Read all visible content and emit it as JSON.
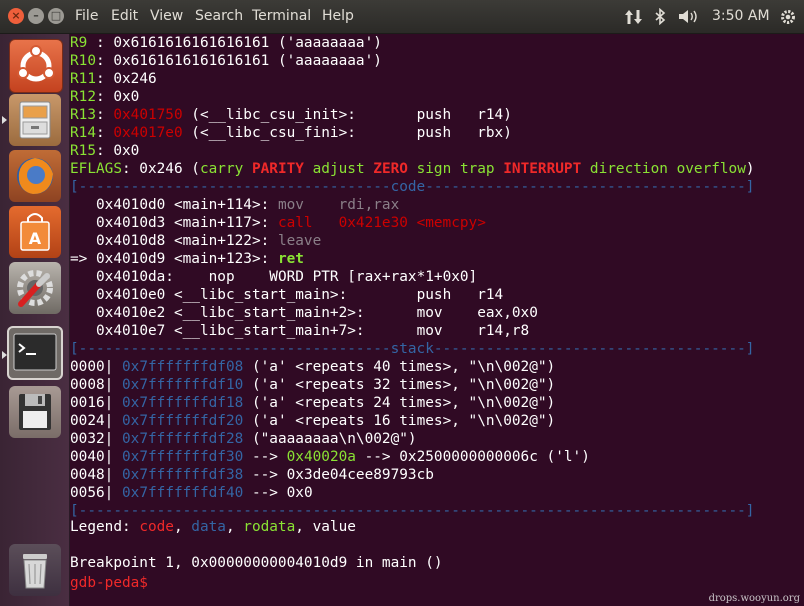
{
  "menubar": {
    "items": [
      "File",
      "Edit",
      "View",
      "Search",
      "Terminal",
      "Help"
    ],
    "tray": {
      "time": "3:50 AM"
    }
  },
  "launcher": {
    "items": [
      "ubuntu-dash",
      "files",
      "firefox",
      "software-center",
      "system-settings",
      "terminal",
      "floppy-disk",
      "trash"
    ]
  },
  "registers": [
    {
      "name": "R9",
      "sep": " : ",
      "value": "0x6161616161616161",
      "rest": " ('aaaaaaaa')"
    },
    {
      "name": "R10",
      "sep": ": ",
      "value": "0x6161616161616161",
      "rest": " ('aaaaaaaa')"
    },
    {
      "name": "R11",
      "sep": ": ",
      "value": "0x246",
      "rest": ""
    },
    {
      "name": "R12",
      "sep": ": ",
      "value": "0x0",
      "rest": ""
    },
    {
      "name": "R13",
      "sep": ": ",
      "value": "0x401750",
      "rest": " (<__libc_csu_init>:       push   r14)"
    },
    {
      "name": "R14",
      "sep": ": ",
      "value": "0x4017e0",
      "rest": " (<__libc_csu_fini>:       push   rbx)"
    },
    {
      "name": "R15",
      "sep": ": ",
      "value": "0x0",
      "rest": ""
    }
  ],
  "eflags": {
    "label": "EFLAGS",
    "value": ": 0x246 (",
    "flags": [
      {
        "t": "carry",
        "on": false
      },
      {
        "t": "PARITY",
        "on": true
      },
      {
        "t": "adjust",
        "on": false
      },
      {
        "t": "ZERO",
        "on": true
      },
      {
        "t": "sign",
        "on": false
      },
      {
        "t": "trap",
        "on": false
      },
      {
        "t": "INTERRUPT",
        "on": true
      },
      {
        "t": "direction",
        "on": false
      },
      {
        "t": "overflow",
        "on": false
      }
    ],
    "close": ")"
  },
  "code_header": "[------------------------------------code-------------------------------------]",
  "code": [
    {
      "prefix": "   ",
      "addr": "0x4010d0 <main+114>:",
      "instr": " mov    rdi,rax",
      "style": "dim"
    },
    {
      "prefix": "   ",
      "addr": "0x4010d3 <main+117>:",
      "instr": " call   0x421e30 <memcpy>",
      "style": "call"
    },
    {
      "prefix": "   ",
      "addr": "0x4010d8 <main+122>:",
      "instr": " leave",
      "style": "dim"
    },
    {
      "prefix": "=> ",
      "addr": "0x4010d9 <main+123>:",
      "instr": " ret",
      "style": "current"
    },
    {
      "prefix": "   ",
      "addr": "0x4010da:",
      "instr": "    nop    WORD PTR [rax+rax*1+0x0]",
      "style": "normal"
    },
    {
      "prefix": "   ",
      "addr": "0x4010e0 <__libc_start_main>:",
      "instr": "        push   r14",
      "style": "normal"
    },
    {
      "prefix": "   ",
      "addr": "0x4010e2 <__libc_start_main+2>:",
      "instr": "      mov    eax,0x0",
      "style": "normal"
    },
    {
      "prefix": "   ",
      "addr": "0x4010e7 <__libc_start_main+7>:",
      "instr": "      mov    r14,r8",
      "style": "normal"
    }
  ],
  "stack_header": "[------------------------------------stack------------------------------------]",
  "stack": [
    {
      "off": "0000|",
      "addr": "0x7fffffffdf08",
      "rest": " ('a' <repeats 40 times>, \"\\n\\002@\")",
      "mid": "",
      "tail": ""
    },
    {
      "off": "0008|",
      "addr": "0x7fffffffdf10",
      "rest": " ('a' <repeats 32 times>, \"\\n\\002@\")",
      "mid": "",
      "tail": ""
    },
    {
      "off": "0016|",
      "addr": "0x7fffffffdf18",
      "rest": " ('a' <repeats 24 times>, \"\\n\\002@\")",
      "mid": "",
      "tail": ""
    },
    {
      "off": "0024|",
      "addr": "0x7fffffffdf20",
      "rest": " ('a' <repeats 16 times>, \"\\n\\002@\")",
      "mid": "",
      "tail": ""
    },
    {
      "off": "0032|",
      "addr": "0x7fffffffdf28",
      "rest": " (\"aaaaaaaa\\n\\002@\")",
      "mid": "",
      "tail": ""
    },
    {
      "off": "0040|",
      "addr": "0x7fffffffdf30",
      "rest": " --> ",
      "mid": "0x40020a",
      "tail": " --> 0x2500000000006c ('l')"
    },
    {
      "off": "0048|",
      "addr": "0x7fffffffdf38",
      "rest": " --> 0x3de04cee89793cb",
      "mid": "",
      "tail": ""
    },
    {
      "off": "0056|",
      "addr": "0x7fffffffdf40",
      "rest": " --> 0x0",
      "mid": "",
      "tail": ""
    }
  ],
  "footer_rule": "[-----------------------------------------------------------------------------]",
  "legend": {
    "label": "Legend: ",
    "code": "code",
    "sep1": ", ",
    "data": "data",
    "sep2": ", ",
    "rodata": "rodata",
    "sep3": ", ",
    "value": "value"
  },
  "breakpoint": "Breakpoint 1, 0x00000000004010d9 in main ()",
  "prompt": "gdb-peda$ ",
  "watermark": "drops.wooyun.org",
  "colors": {
    "bg": "#300a24",
    "reg": "#8ae234",
    "code": "#ef2929",
    "data": "#3465a4",
    "rodata": "#8ae234"
  }
}
